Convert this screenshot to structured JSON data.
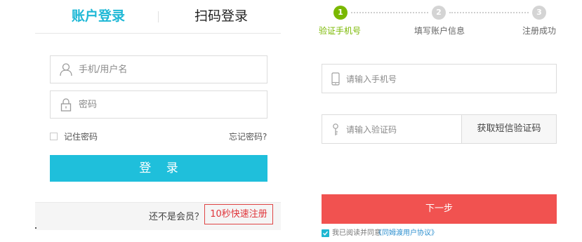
{
  "login": {
    "tabs": {
      "account": "账户登录",
      "qr": "扫码登录"
    },
    "username_placeholder": "手机/用户名",
    "password_placeholder": "密码",
    "remember_label": "记住密码",
    "forgot_label": "忘记密码?",
    "login_button": "登 录",
    "register_question": "还不是会员？",
    "register_link": "10秒快速注册"
  },
  "register": {
    "steps": [
      {
        "number": "1",
        "label": "验证手机号",
        "state": "active"
      },
      {
        "number": "2",
        "label": "填写账户信息",
        "state": "pending"
      },
      {
        "number": "3",
        "label": "注册成功",
        "state": "pending"
      }
    ],
    "phone_placeholder": "请输入手机号",
    "code_placeholder": "请输入验证码",
    "sms_button": "获取短信验证码",
    "next_button": "下一步",
    "agree_text": "我已阅读并同意",
    "agree_link": "《同姆渡用户协议》",
    "agree_checked": true
  },
  "colors": {
    "accent_cyan": "#1fbfdb",
    "step_green": "#7ab800",
    "next_red": "#f15250",
    "register_red": "#e0353a"
  },
  "icons": [
    "user-icon",
    "lock-icon",
    "phone-icon",
    "key-icon",
    "checkmark-icon"
  ]
}
